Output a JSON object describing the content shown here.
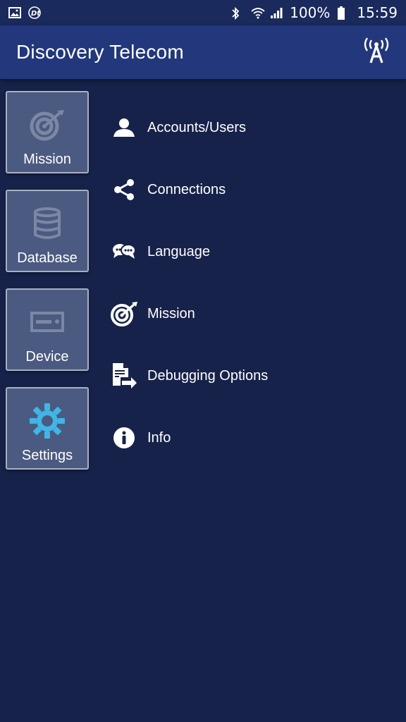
{
  "status_bar": {
    "battery": "100%",
    "time": "15:59",
    "icons": [
      "gallery-icon",
      "dt-app-icon",
      "bluetooth-icon",
      "wifi-icon",
      "signal-icon",
      "battery-icon"
    ]
  },
  "app_bar": {
    "title": "Discovery Telecom",
    "action_icon": "antenna-icon"
  },
  "categories": [
    {
      "label": "Mission",
      "icon": "target-icon",
      "active": false
    },
    {
      "label": "Database",
      "icon": "database-icon",
      "active": false
    },
    {
      "label": "Device",
      "icon": "device-icon",
      "active": false
    },
    {
      "label": "Settings",
      "icon": "gear-icon",
      "active": true
    }
  ],
  "settings_menu": [
    {
      "label": "Accounts/Users",
      "icon": "user-icon"
    },
    {
      "label": "Connections",
      "icon": "share-icon"
    },
    {
      "label": "Language",
      "icon": "speech-bubbles-icon"
    },
    {
      "label": "Mission",
      "icon": "target-icon"
    },
    {
      "label": "Debugging Options",
      "icon": "export-document-icon"
    },
    {
      "label": "Info",
      "icon": "info-icon"
    }
  ],
  "colors": {
    "background": "#16224a",
    "app_bar": "#22377c",
    "status_bar": "#1b2a5c",
    "tile": "#4b5a80",
    "active_icon": "#3fb6e6",
    "inactive_icon": "#7b87a3"
  }
}
